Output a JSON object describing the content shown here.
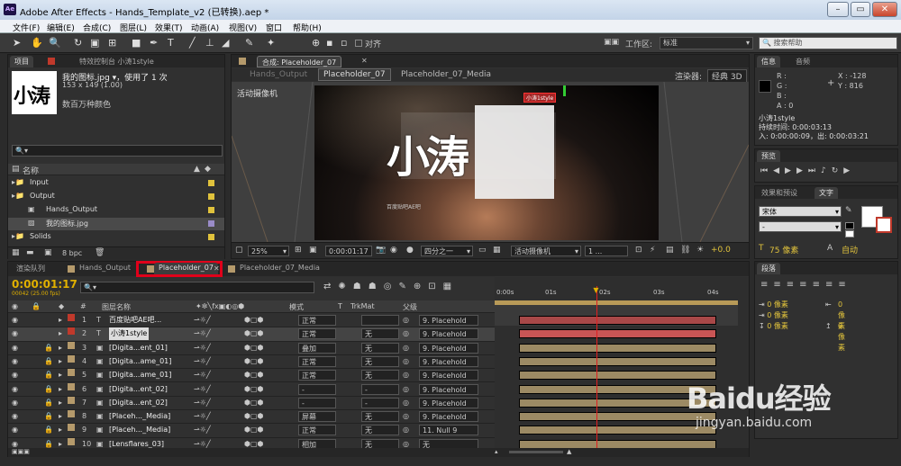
{
  "app": {
    "title": "Adobe After Effects - Hands_Template_v2 (已转换).aep *",
    "logo": "Ae"
  },
  "menu": [
    "文件(F)",
    "编辑(E)",
    "合成(C)",
    "图层(L)",
    "效果(T)",
    "动画(A)",
    "视图(V)",
    "窗口",
    "帮助(H)"
  ],
  "toolbar": {
    "align_label": "对齐",
    "workspace_label": "工作区:",
    "workspace_value": "标准",
    "search_placeholder": "搜索帮助"
  },
  "project": {
    "tab_label": "项目",
    "effects_tab": "特效控制台 小涛1style",
    "item_name": "我的图标.jpg ▾",
    "item_usage": "，使用了 1 次",
    "item_dims": "153 x 149 (1.00)",
    "item_colors": "数百万种颜色",
    "thumb_text": "小涛",
    "search_placeholder": "🔍▾",
    "col_name": "名称",
    "items": [
      {
        "name": "Input",
        "type": "folder",
        "color": "#e0c23c"
      },
      {
        "name": "Output",
        "type": "folder",
        "color": "#e0c23c"
      },
      {
        "name": "Hands_Output",
        "type": "comp",
        "color": "#e0c23c"
      },
      {
        "name": "我的图标.jpg",
        "type": "image",
        "color": "#9a8cc8"
      },
      {
        "name": "Solids",
        "type": "folder",
        "color": "#e0c23c"
      }
    ],
    "bpc": "8 bpc"
  },
  "composition": {
    "tab_label": "合成: Placeholder_07",
    "subtabs": [
      "Hands_Output",
      "Placeholder_07",
      "Placeholder_07_Media"
    ],
    "renderer_label": "渲染器:",
    "renderer_value": "经典 3D",
    "camera_label": "活动摄像机",
    "logo_text": "小涛",
    "layer_label": "小涛1style",
    "small_caption": "百度贴吧AE吧",
    "zoom": "25%",
    "timecode": "0:00:01:17",
    "resolution": "四分之一",
    "view": "活动摄像机",
    "view_count": "1 ...",
    "exposure": "+0.0"
  },
  "info": {
    "tabs": [
      "信息",
      "音频"
    ],
    "r": "R :",
    "g": "G :",
    "b": "B :",
    "a": "A : 0",
    "x": "X : -128",
    "y": "Y : 816",
    "layer_name": "小涛1style",
    "duration": "持续时间: 0:00:03:13",
    "in_out": "入: 0:00:00:09，出: 0:00:03:21"
  },
  "preview": {
    "tab": "预览"
  },
  "effects": {
    "tabs": [
      "效果和预设",
      "文字"
    ],
    "font": "宋体",
    "style": "-",
    "size": "75 像素",
    "auto_label": "自动"
  },
  "paragraph": {
    "tab": "段落",
    "values": [
      "0 像素",
      "0 像素",
      "0 像素",
      "0 像素",
      "0 像素"
    ]
  },
  "timeline": {
    "tabs": [
      "渲染队列",
      "Hands_Output",
      "Placeholder_07",
      "Placeholder_07_Media"
    ],
    "timecode": "0:00:01:17",
    "frame_info": "00042 (25.00 fps)",
    "search_placeholder": "🔍▾",
    "col_num": "#",
    "col_name": "图层名称",
    "col_mode": "模式",
    "col_t": "T",
    "col_trkmat": "TrkMat",
    "col_parent": "父级",
    "ruler": [
      "0:00s",
      "01s",
      "02s",
      "03s",
      "04s"
    ],
    "playhead_fraction": 0.42,
    "layers": [
      {
        "num": "1",
        "name": "百度贴吧AE吧...",
        "mode": "正常",
        "trk": "",
        "parent": "9. Placehold",
        "color": "#c0392b",
        "bar": "#a84848",
        "start": 0.1,
        "end": 0.91
      },
      {
        "num": "2",
        "name": "小涛1style",
        "mode": "正常",
        "trk": "无",
        "parent": "9. Placehold",
        "color": "#c0392b",
        "bar": "#c95555",
        "start": 0.1,
        "end": 0.91
      },
      {
        "num": "3",
        "name": "[Digita...ent_01]",
        "mode": "叠加",
        "trk": "无",
        "parent": "9. Placehold",
        "color": "#b59a6b",
        "bar": "#9c8a64",
        "start": 0.1,
        "end": 0.91
      },
      {
        "num": "4",
        "name": "[Digita...ame_01]",
        "mode": "正常",
        "trk": "无",
        "parent": "9. Placehold",
        "color": "#b59a6b",
        "bar": "#9c8a64",
        "start": 0.1,
        "end": 0.91
      },
      {
        "num": "5",
        "name": "[Digita...ame_01]",
        "mode": "正常",
        "trk": "无",
        "parent": "9. Placehold",
        "color": "#b59a6b",
        "bar": "#9c8a64",
        "start": 0.1,
        "end": 0.91
      },
      {
        "num": "6",
        "name": "[Digita...ent_02]",
        "mode": "-",
        "trk": "-",
        "parent": "9. Placehold",
        "color": "#b59a6b",
        "bar": "#9c8a64",
        "start": 0.1,
        "end": 0.91
      },
      {
        "num": "7",
        "name": "[Digita...ent_02]",
        "mode": "-",
        "trk": "-",
        "parent": "9. Placehold",
        "color": "#b59a6b",
        "bar": "#9c8a64",
        "start": 0.1,
        "end": 0.91
      },
      {
        "num": "8",
        "name": "[Placeh..._Media]",
        "mode": "屏幕",
        "trk": "无",
        "parent": "9. Placehold",
        "color": "#b59a6b",
        "bar": "#9c8a64",
        "start": 0.1,
        "end": 0.91
      },
      {
        "num": "9",
        "name": "[Placeh..._Media]",
        "mode": "正常",
        "trk": "无",
        "parent": "11. Null 9",
        "color": "#b59a6b",
        "bar": "#9c8a64",
        "start": 0.1,
        "end": 0.91
      },
      {
        "num": "10",
        "name": "[Lensflares_03]",
        "mode": "相加",
        "trk": "无",
        "parent": "无",
        "color": "#b59a6b",
        "bar": "#9c8a64",
        "start": 0.1,
        "end": 0.91
      }
    ]
  },
  "watermark": {
    "text": "Baidu经验",
    "url": "jingyan.baidu.com"
  }
}
